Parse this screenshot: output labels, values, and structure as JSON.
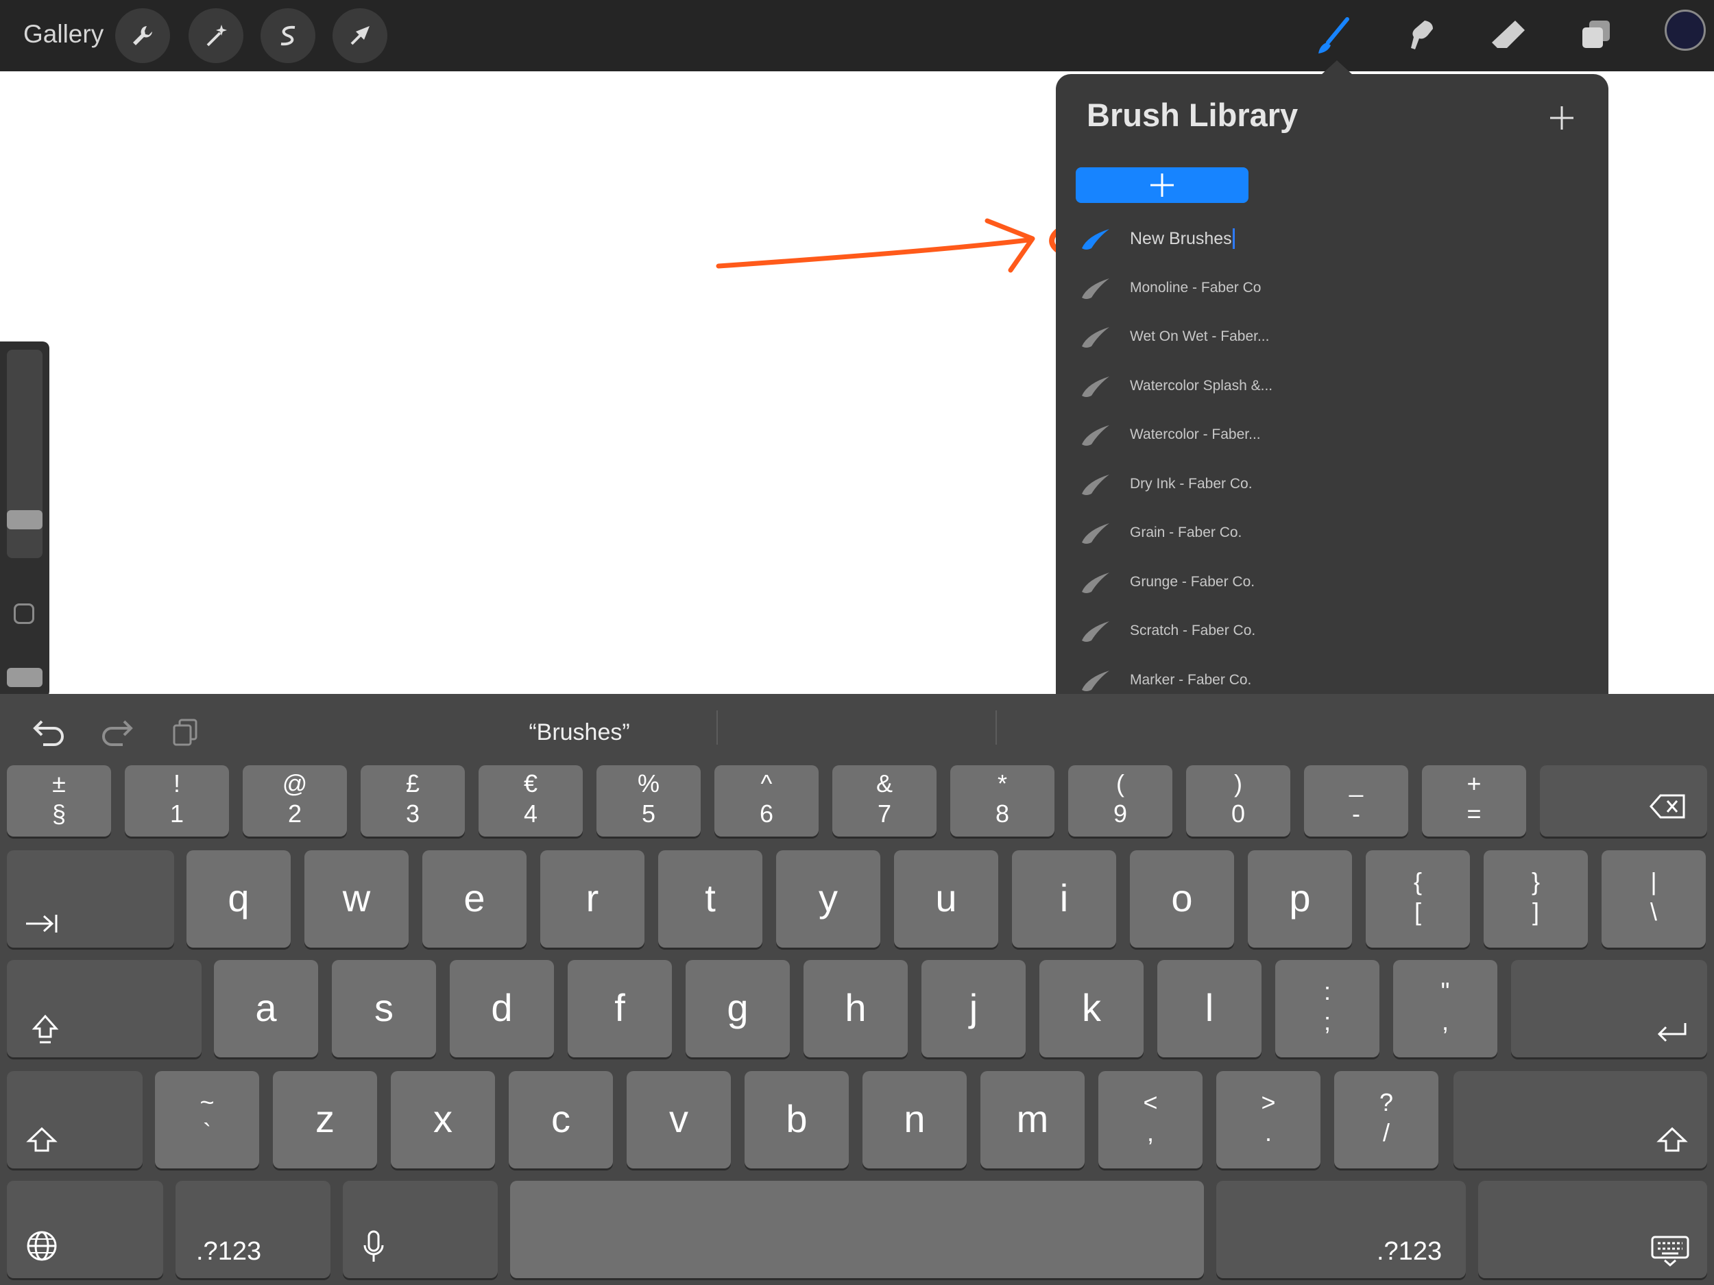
{
  "toolbar": {
    "gallery_label": "Gallery",
    "left_tools": [
      "wrench-icon",
      "magic-wand-icon",
      "selection-icon",
      "transform-icon"
    ],
    "right_tools": [
      "brush-icon",
      "smudge-icon",
      "eraser-icon",
      "layers-icon"
    ],
    "active_tool": "brush-icon",
    "active_color": "#1a1c3a",
    "accent_color": "#1784ff"
  },
  "brush_library": {
    "title": "Brush Library",
    "brush_sets": [
      {
        "label": "New Brushes",
        "active": true
      },
      {
        "label": "Monoline - Faber Co"
      },
      {
        "label": "Wet On Wet - Faber..."
      },
      {
        "label": "Watercolor Splash &..."
      },
      {
        "label": "Watercolor - Faber..."
      },
      {
        "label": "Dry Ink - Faber Co."
      },
      {
        "label": "Grain - Faber Co."
      },
      {
        "label": "Grunge - Faber Co."
      },
      {
        "label": "Scratch - Faber Co."
      },
      {
        "label": "Marker - Faber Co."
      }
    ]
  },
  "annotation": {
    "color": "#ff5a1a"
  },
  "keyboard": {
    "suggestion": "“Brushes”",
    "number_row": [
      {
        "top": "±",
        "bot": "§"
      },
      {
        "top": "!",
        "bot": "1"
      },
      {
        "top": "@",
        "bot": "2"
      },
      {
        "top": "£",
        "bot": "3"
      },
      {
        "top": "€",
        "bot": "4"
      },
      {
        "top": "%",
        "bot": "5"
      },
      {
        "top": "^",
        "bot": "6"
      },
      {
        "top": "&",
        "bot": "7"
      },
      {
        "top": "*",
        "bot": "8"
      },
      {
        "top": "(",
        "bot": "9"
      },
      {
        "top": ")",
        "bot": "0"
      },
      {
        "top": "_",
        "bot": "-"
      },
      {
        "top": "+",
        "bot": "="
      }
    ],
    "row_q": [
      "q",
      "w",
      "e",
      "r",
      "t",
      "y",
      "u",
      "i",
      "o",
      "p"
    ],
    "row_q_sym": [
      {
        "top": "{",
        "bot": "["
      },
      {
        "top": "}",
        "bot": "]"
      },
      {
        "top": "|",
        "bot": "\\"
      }
    ],
    "row_a": [
      "a",
      "s",
      "d",
      "f",
      "g",
      "h",
      "j",
      "k",
      "l"
    ],
    "row_a_sym": [
      {
        "top": ":",
        "bot": ";"
      },
      {
        "top": "\"",
        "bot": ","
      }
    ],
    "row_z_sym_first": {
      "top": "~",
      "bot": "`"
    },
    "row_z": [
      "z",
      "x",
      "c",
      "v",
      "b",
      "n",
      "m"
    ],
    "row_z_sym": [
      {
        "top": "<",
        "bot": ","
      },
      {
        "top": ">",
        "bot": "."
      },
      {
        "top": "?",
        "bot": "/"
      }
    ],
    "numbers_label_left": ".?123",
    "numbers_label_right": ".?123"
  }
}
